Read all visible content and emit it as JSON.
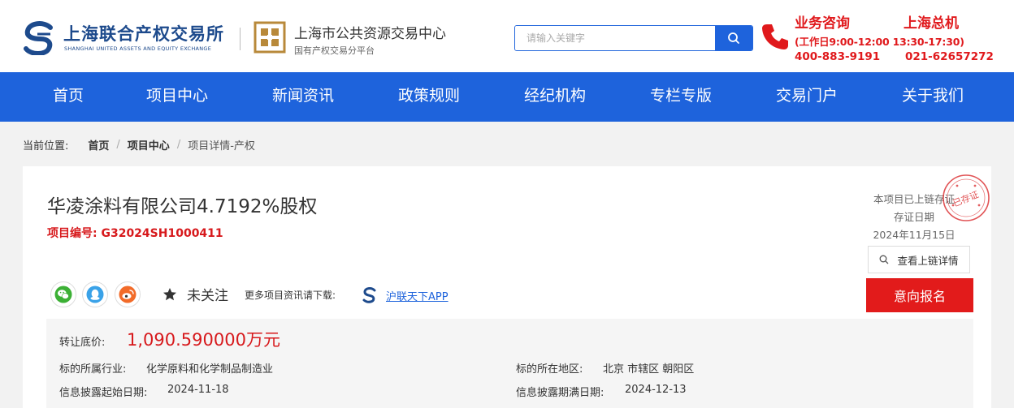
{
  "header": {
    "logo1_cn": "上海联合产权交易所",
    "logo1_en": "SHANGHAI UNITED ASSETS AND EQUITY EXCHANGE",
    "logo2_cn": "上海市公共资源交易中心",
    "logo2_sub": "国有产权交易分平台",
    "search_placeholder": "请输入关键字",
    "hotline_business": "业务咨询",
    "hotline_hq": "上海总机",
    "hours": "(工作日9:00-12:00 13:30-17:30)",
    "tel_business": "400-883-9191",
    "tel_hq": "021-62657272"
  },
  "nav": {
    "items": [
      "首页",
      "项目中心",
      "新闻资讯",
      "政策规则",
      "经纪机构",
      "专栏专版",
      "交易门户",
      "关于我们"
    ]
  },
  "breadcrumb": {
    "label": "当前位置:",
    "items": [
      "首页",
      "项目中心",
      "项目详情-产权"
    ]
  },
  "project": {
    "title": "华凌涂料有限公司4.7192%股权",
    "code": "项目编号: G32024SH1000411",
    "chain_note_1": "本项目已上链存证",
    "chain_note_2": "存证日期",
    "chain_date": "2024年11月15日",
    "stamp_text": "已存证",
    "chain_button": "查看上链详情",
    "apply_button": "意向报名",
    "follow_label": "未关注",
    "download_text": "更多项目资讯请下载:",
    "app_link": "沪联天下APP",
    "price_label": "转让底价:",
    "price_value": "1,090.590000万元",
    "industry_label": "标的所属行业:",
    "industry_value": "化学原料和化学制品制造业",
    "region_label": "标的所在地区:",
    "region_value": "北京 市辖区 朝阳区",
    "start_label": "信息披露起始日期:",
    "start_value": "2024-11-18",
    "end_label": "信息披露期满日期:",
    "end_value": "2024-12-13"
  },
  "icons": {
    "share": [
      "wechat-icon",
      "qq-icon",
      "weibo-icon"
    ],
    "follow": "star-icon",
    "phone": "phone-icon",
    "search": "search-icon"
  },
  "colors": {
    "brand_blue": "#1e63dc",
    "alert_red": "#e0191c",
    "apply_red": "#e21b1b",
    "wechat_green": "#3cb035",
    "qq_blue": "#3aa2e8",
    "weibo_orange": "#f26b29"
  }
}
